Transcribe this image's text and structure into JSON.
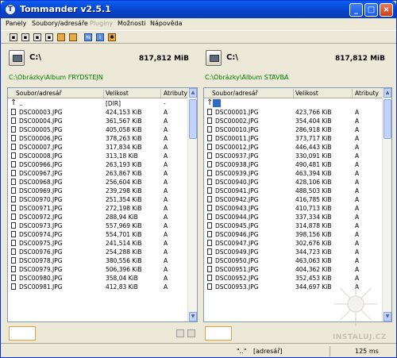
{
  "window": {
    "title": "Tommander v2.5.1"
  },
  "menu": [
    {
      "label": "Panely",
      "enabled": true
    },
    {
      "label": "Soubory/adresáře",
      "enabled": true
    },
    {
      "label": "Pluginy",
      "enabled": false
    },
    {
      "label": "Možnosti",
      "enabled": true
    },
    {
      "label": "Nápověda",
      "enabled": true
    }
  ],
  "toolbar": [
    "save-icon",
    "save-icon",
    "save-icon",
    "save-icon",
    "folder-icon",
    "folder-icon",
    "copy-icon",
    "info-icon",
    "settings-icon"
  ],
  "left": {
    "drive": "C:\\",
    "free": "817,812 MiB",
    "path": "C:\\Obrázky\\Album FRYDSTEJN",
    "headers": [
      "Soubor/adresář",
      "Velikost",
      "Atributy"
    ],
    "rows": [
      {
        "name": "..",
        "size": "[DIR]",
        "attr": "-",
        "up": true
      },
      {
        "name": "DSC00003.JPG",
        "size": "424,153 KiB",
        "attr": "A"
      },
      {
        "name": "DSC00004.JPG",
        "size": "361,567 KiB",
        "attr": "A"
      },
      {
        "name": "DSC00005.JPG",
        "size": "405,058 KiB",
        "attr": "A"
      },
      {
        "name": "DSC00006.JPG",
        "size": "378,263 KiB",
        "attr": "A"
      },
      {
        "name": "DSC00007.JPG",
        "size": "317,834 KiB",
        "attr": "A"
      },
      {
        "name": "DSC00008.JPG",
        "size": "313,18 KiB",
        "attr": "A"
      },
      {
        "name": "DSC00966.JPG",
        "size": "263,193 KiB",
        "attr": "A"
      },
      {
        "name": "DSC00967.JPG",
        "size": "263,867 KiB",
        "attr": "A"
      },
      {
        "name": "DSC00968.JPG",
        "size": "256,604 KiB",
        "attr": "A"
      },
      {
        "name": "DSC00969.JPG",
        "size": "239,298 KiB",
        "attr": "A"
      },
      {
        "name": "DSC00970.JPG",
        "size": "251,354 KiB",
        "attr": "A"
      },
      {
        "name": "DSC00971.JPG",
        "size": "272,198 KiB",
        "attr": "A"
      },
      {
        "name": "DSC00972.JPG",
        "size": "288,94 KiB",
        "attr": "A"
      },
      {
        "name": "DSC00973.JPG",
        "size": "557,969 KiB",
        "attr": "A"
      },
      {
        "name": "DSC00974.JPG",
        "size": "554,701 KiB",
        "attr": "A"
      },
      {
        "name": "DSC00975.JPG",
        "size": "241,514 KiB",
        "attr": "A"
      },
      {
        "name": "DSC00976.JPG",
        "size": "254,288 KiB",
        "attr": "A"
      },
      {
        "name": "DSC00978.JPG",
        "size": "380,556 KiB",
        "attr": "A"
      },
      {
        "name": "DSC00979.JPG",
        "size": "506,396 KiB",
        "attr": "A"
      },
      {
        "name": "DSC00980.JPG",
        "size": "358,04 KiB",
        "attr": "A"
      },
      {
        "name": "DSC00981.JPG",
        "size": "412,83 KiB",
        "attr": "A"
      }
    ]
  },
  "right": {
    "drive": "C:\\",
    "free": "817,812 MiB",
    "path": "C:\\Obrázky\\Album STAVBA",
    "headers": [
      "Soubor/adresář",
      "Velikost",
      "Atributy"
    ],
    "rows": [
      {
        "name": "",
        "size": "",
        "attr": "",
        "up": true,
        "selected": true
      },
      {
        "name": "DSC00001.JPG",
        "size": "423,766 KiB",
        "attr": "A"
      },
      {
        "name": "DSC00002.JPG",
        "size": "354,404 KiB",
        "attr": "A"
      },
      {
        "name": "DSC00010.JPG",
        "size": "286,918 KiB",
        "attr": "A"
      },
      {
        "name": "DSC00011.JPG",
        "size": "373,717 KiB",
        "attr": "A"
      },
      {
        "name": "DSC00012.JPG",
        "size": "446,443 KiB",
        "attr": "A"
      },
      {
        "name": "DSC00937.JPG",
        "size": "330,091 KiB",
        "attr": "A"
      },
      {
        "name": "DSC00938.JPG",
        "size": "490,481 KiB",
        "attr": "A"
      },
      {
        "name": "DSC00939.JPG",
        "size": "463,394 KiB",
        "attr": "A"
      },
      {
        "name": "DSC00940.JPG",
        "size": "428,106 KiB",
        "attr": "A"
      },
      {
        "name": "DSC00941.JPG",
        "size": "488,503 KiB",
        "attr": "A"
      },
      {
        "name": "DSC00942.JPG",
        "size": "416,785 KiB",
        "attr": "A"
      },
      {
        "name": "DSC00943.JPG",
        "size": "410,713 KiB",
        "attr": "A"
      },
      {
        "name": "DSC00944.JPG",
        "size": "337,334 KiB",
        "attr": "A"
      },
      {
        "name": "DSC00945.JPG",
        "size": "314,878 KiB",
        "attr": "A"
      },
      {
        "name": "DSC00946.JPG",
        "size": "398,156 KiB",
        "attr": "A"
      },
      {
        "name": "DSC00947.JPG",
        "size": "302,676 KiB",
        "attr": "A"
      },
      {
        "name": "DSC00949.JPG",
        "size": "344,723 KiB",
        "attr": "A"
      },
      {
        "name": "DSC00950.JPG",
        "size": "463,063 KiB",
        "attr": "A"
      },
      {
        "name": "DSC00951.JPG",
        "size": "404,362 KiB",
        "attr": "A"
      },
      {
        "name": "DSC00952.JPG",
        "size": "352,453 KiB",
        "attr": "A"
      },
      {
        "name": "DSC00953.JPG",
        "size": "344,697 KiB",
        "attr": "A"
      }
    ]
  },
  "status": {
    "name": "\"..\"",
    "type": "[adresář]",
    "time": "125 ms"
  },
  "watermark": "INSTALUJ.CZ"
}
